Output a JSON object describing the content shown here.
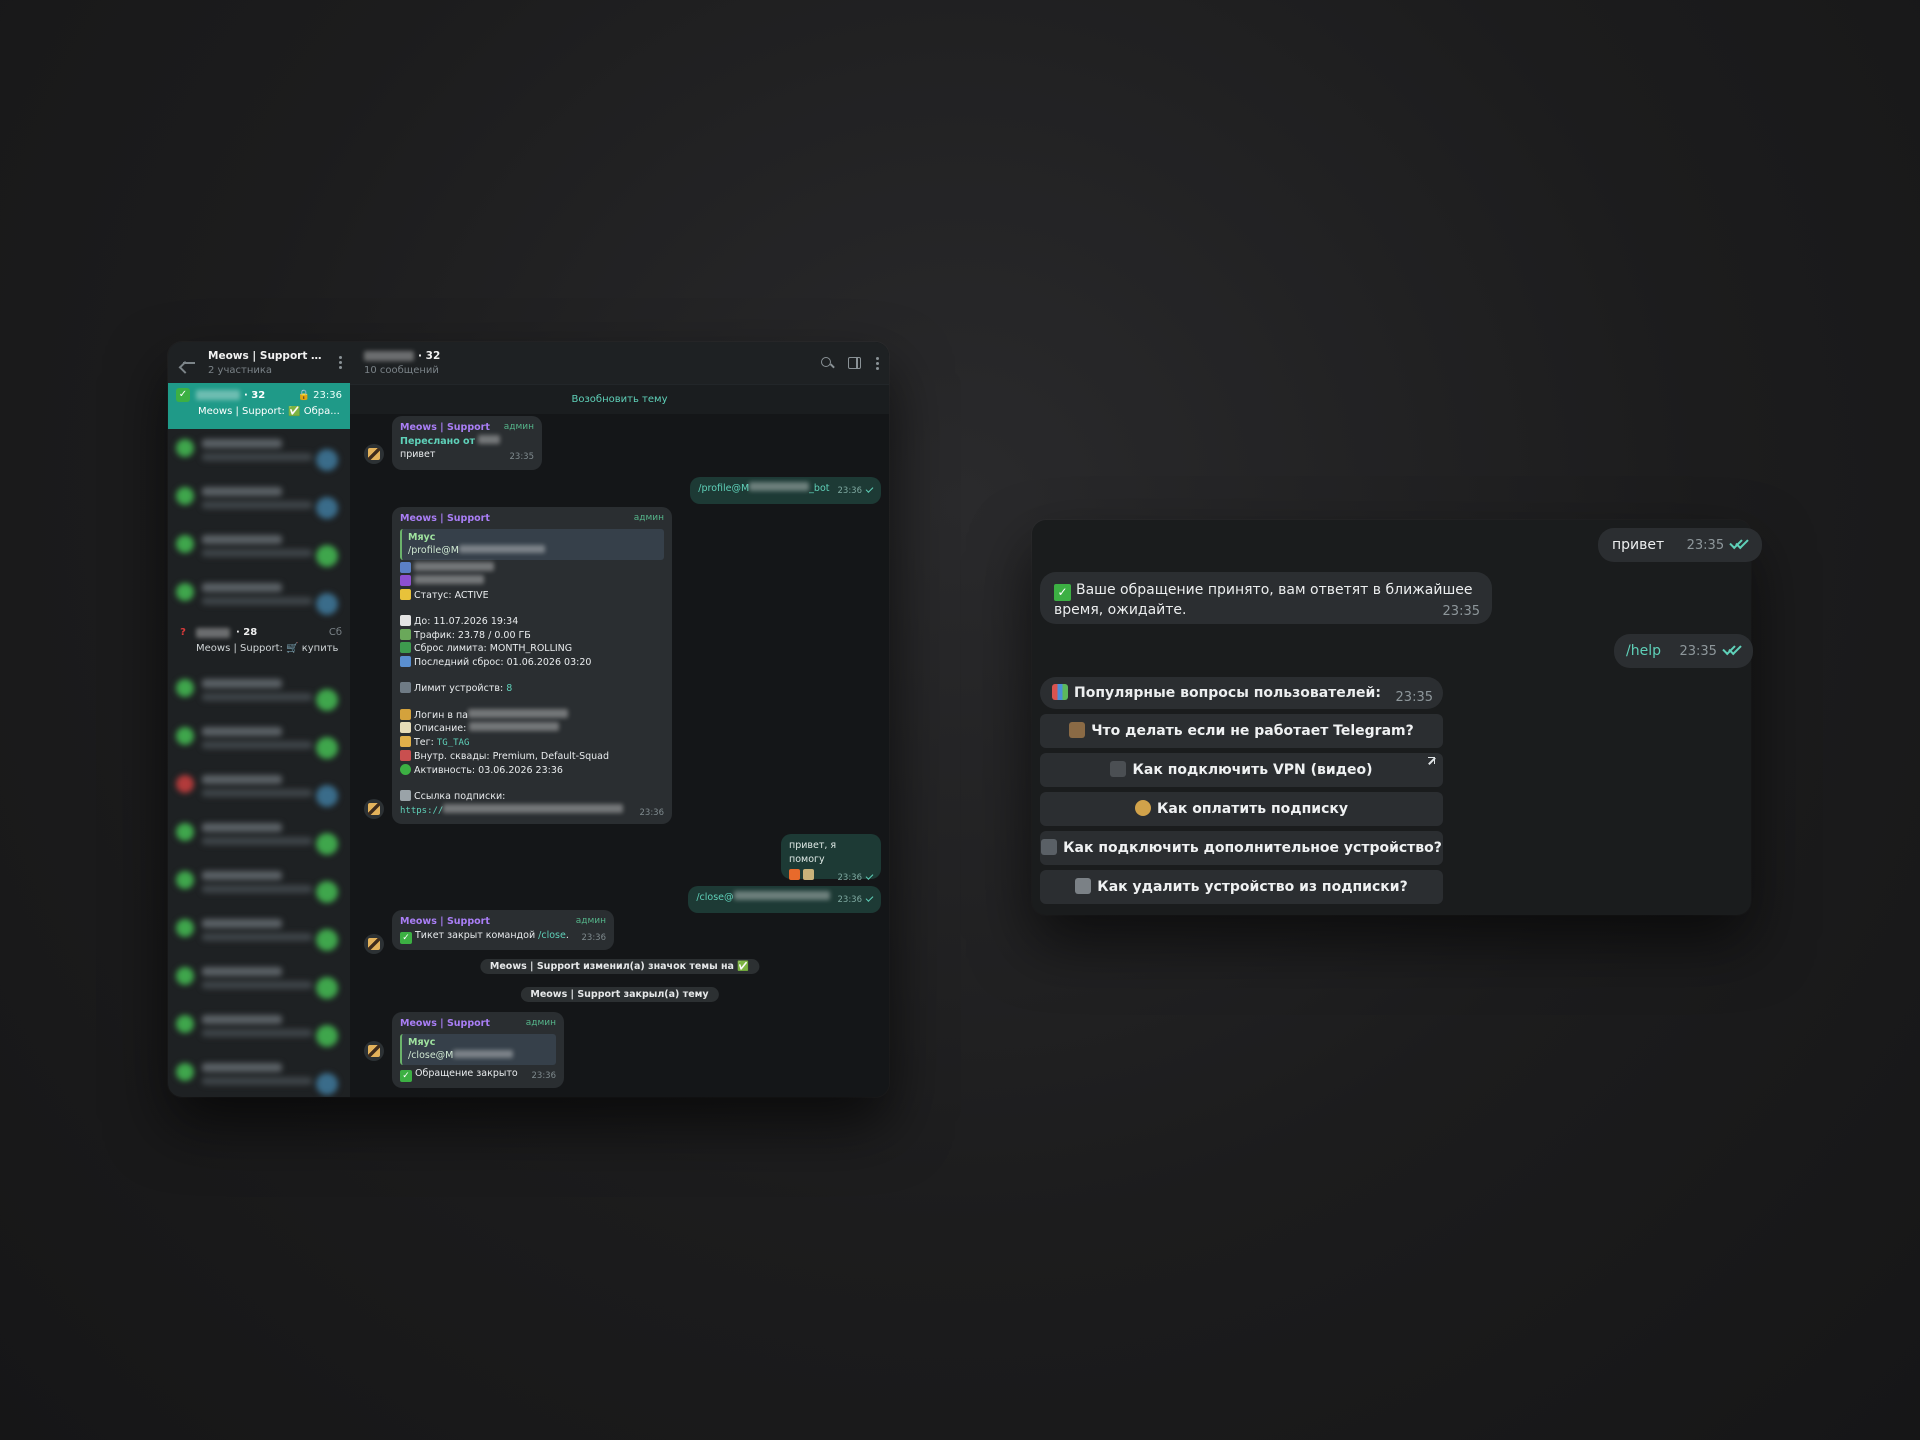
{
  "left_window": {
    "sidebar": {
      "title": "Meows | Support A...",
      "subtitle": "2 участника",
      "active_chat": {
        "badge": "✓",
        "number": "· 32",
        "time": "23:36",
        "preview": "Meows | Support: ✅ Обра..."
      },
      "question_chat": {
        "badge": "?",
        "number": "· 28",
        "day": "Сб",
        "preview": "Meows | Support: 🛒 купить"
      }
    },
    "header": {
      "title_suffix": "· 32",
      "subtitle": "10 сообщений"
    },
    "reopen_label": "Возобновить тему",
    "messages": {
      "m1": {
        "sender": "Meows | Support",
        "admin": "админ",
        "forwarded": "Переслано от",
        "text": "привет",
        "time": "23:35"
      },
      "m2": {
        "text_prefix": "/profile@M",
        "text_suffix": "_bot",
        "time": "23:36"
      },
      "m3": {
        "sender": "Meows | Support",
        "admin": "админ",
        "quote_name": "Мяус",
        "quote_text": "/profile@M",
        "status": "Статус: ACTIVE",
        "until": "До: 11.07.2026 19:34",
        "traffic": "Трафик: 23.78 / 0.00 ГБ",
        "reset": "Сброс лимита: MONTH_ROLLING",
        "last_reset": "Последний сброс: 01.06.2026 03:20",
        "device_limit": "Лимит устройств:",
        "device_limit_value": "8",
        "login": "Логин в па",
        "description": "Описание:",
        "tag": "Тег:",
        "tag_value": "TG_TAG",
        "squads": "Внутр. сквады: Premium, Default-Squad",
        "activity": "Активность: 03.06.2026 23:36",
        "sub_link": "Ссылка подписки:",
        "link_prefix": "https://",
        "time": "23:36"
      },
      "m4": {
        "text": "привет, я помогу",
        "time": "23:36"
      },
      "m5": {
        "text": "/close@",
        "time": "23:36"
      },
      "m6": {
        "sender": "Meows | Support",
        "admin": "админ",
        "text": "Тикет закрыт командой",
        "cmd": "/close",
        "dot": ".",
        "time": "23:36"
      },
      "svc1": "Meows | Support изменил(а) значок темы на ✅",
      "svc2": "Meows | Support закрыл(а) тему",
      "m7": {
        "sender": "Meows | Support",
        "admin": "админ",
        "quote_name": "Мяус",
        "quote_text": "/close@M",
        "text": "Обращение закрыто",
        "time": "23:36"
      }
    }
  },
  "right_window": {
    "msg_hello": {
      "text": "привет",
      "time": "23:35"
    },
    "msg_accepted": {
      "text": "Ваше обращение принято, вам ответят в ближайшее время, ожидайте.",
      "time": "23:35"
    },
    "msg_help": {
      "text": "/help",
      "time": "23:35"
    },
    "msg_popular": {
      "text": "Популярные вопросы пользователей:",
      "time": "23:35"
    },
    "buttons": [
      "Что делать если не работает Telegram?",
      "Как подключить VPN (видео)",
      "Как оплатить подписку",
      "Как подключить дополнительное устройство?",
      "Как удалить устройство из подписки?"
    ]
  }
}
